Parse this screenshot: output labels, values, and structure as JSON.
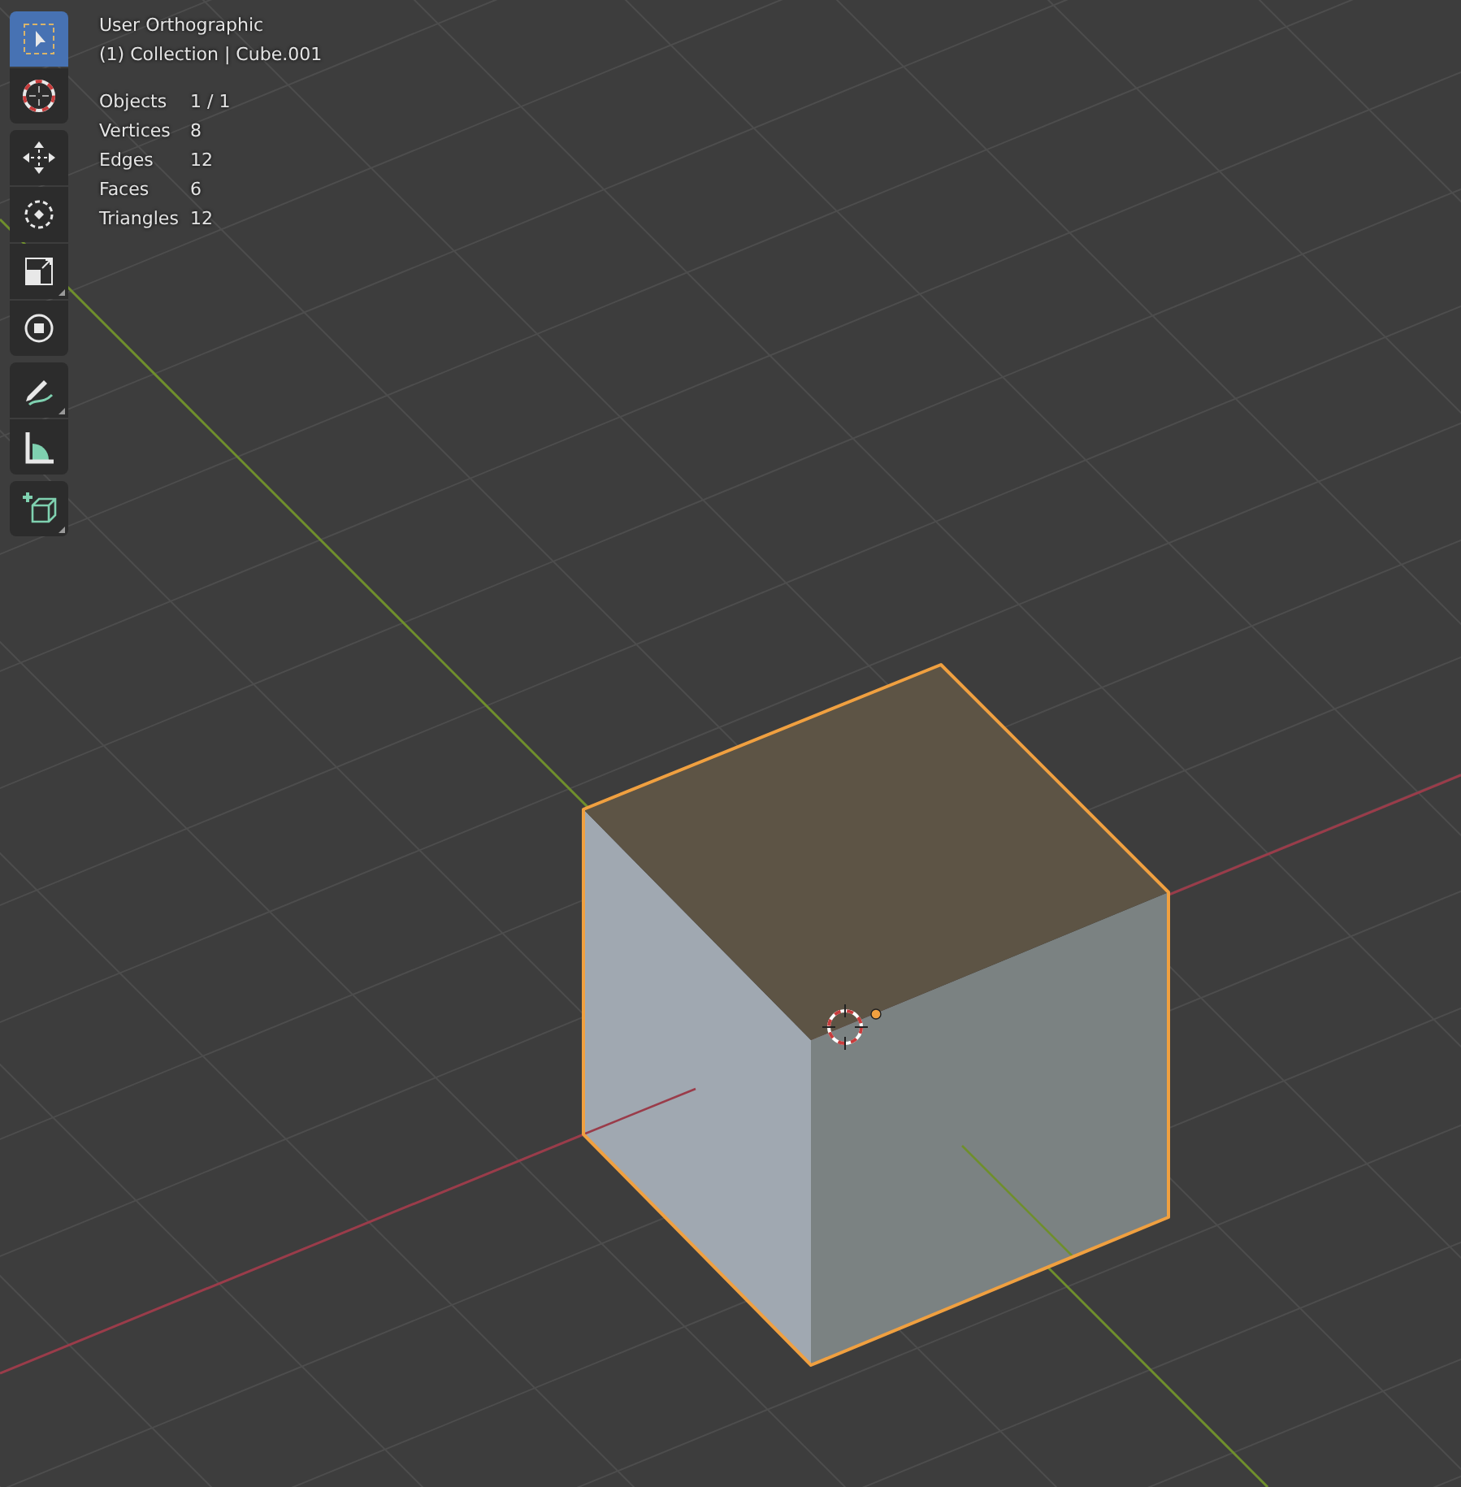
{
  "viewport": {
    "view_name": "User Orthographic",
    "context": "(1) Collection | Cube.001",
    "stats": [
      {
        "label": "Objects",
        "value": "1 / 1"
      },
      {
        "label": "Vertices",
        "value": "8"
      },
      {
        "label": "Edges",
        "value": "12"
      },
      {
        "label": "Faces",
        "value": "6"
      },
      {
        "label": "Triangles",
        "value": "12"
      }
    ]
  },
  "toolbar": {
    "groups": [
      {
        "tools": [
          {
            "kind": "select_box",
            "selected": true,
            "submenu": false
          },
          {
            "kind": "cursor",
            "selected": false,
            "submenu": false
          }
        ]
      },
      {
        "tools": [
          {
            "kind": "move",
            "selected": false,
            "submenu": false
          },
          {
            "kind": "rotate",
            "selected": false,
            "submenu": false
          },
          {
            "kind": "scale",
            "selected": false,
            "submenu": true
          },
          {
            "kind": "transform",
            "selected": false,
            "submenu": false
          }
        ]
      },
      {
        "tools": [
          {
            "kind": "annotate",
            "selected": false,
            "submenu": true
          },
          {
            "kind": "measure",
            "selected": false,
            "submenu": false
          }
        ]
      },
      {
        "tools": [
          {
            "kind": "add_cube",
            "selected": false,
            "submenu": true
          }
        ]
      }
    ]
  }
}
